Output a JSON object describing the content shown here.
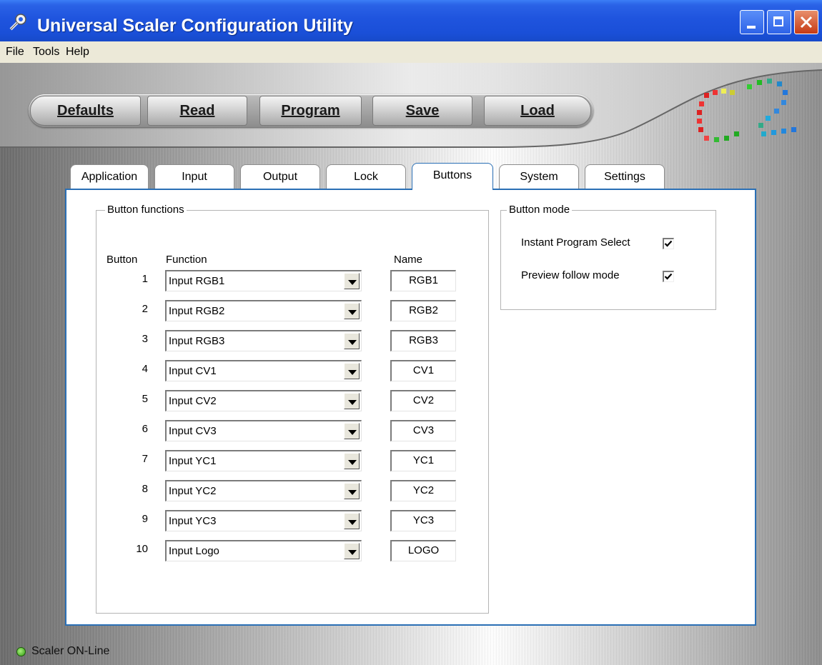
{
  "window": {
    "title": "Universal Scaler Configuration Utility"
  },
  "menu": [
    "File",
    "Tools",
    "Help"
  ],
  "toolbar": [
    "Defaults",
    "Read",
    "Program",
    "Save",
    "Load"
  ],
  "tabs": [
    "Application",
    "Input",
    "Output",
    "Lock",
    "Buttons",
    "System",
    "Settings"
  ],
  "active_tab": "Buttons",
  "button_functions": {
    "title": "Button functions",
    "col_button": "Button",
    "col_function": "Function",
    "col_name": "Name",
    "rows": [
      {
        "num": "1",
        "function": "Input RGB1",
        "name": "RGB1"
      },
      {
        "num": "2",
        "function": "Input RGB2",
        "name": "RGB2"
      },
      {
        "num": "3",
        "function": "Input RGB3",
        "name": "RGB3"
      },
      {
        "num": "4",
        "function": "Input CV1",
        "name": "CV1"
      },
      {
        "num": "5",
        "function": "Input CV2",
        "name": "CV2"
      },
      {
        "num": "6",
        "function": "Input CV3",
        "name": "CV3"
      },
      {
        "num": "7",
        "function": "Input YC1",
        "name": "YC1"
      },
      {
        "num": "8",
        "function": "Input YC2",
        "name": "YC2"
      },
      {
        "num": "9",
        "function": "Input YC3",
        "name": "YC3"
      },
      {
        "num": "10",
        "function": "Input Logo",
        "name": "LOGO"
      }
    ]
  },
  "button_mode": {
    "title": "Button mode",
    "instant_program_select": {
      "label": "Instant Program Select",
      "checked": true
    },
    "preview_follow_mode": {
      "label": "Preview follow mode",
      "checked": true
    }
  },
  "status": {
    "text": "Scaler ON-Line",
    "led_color": "#2f9b12"
  }
}
